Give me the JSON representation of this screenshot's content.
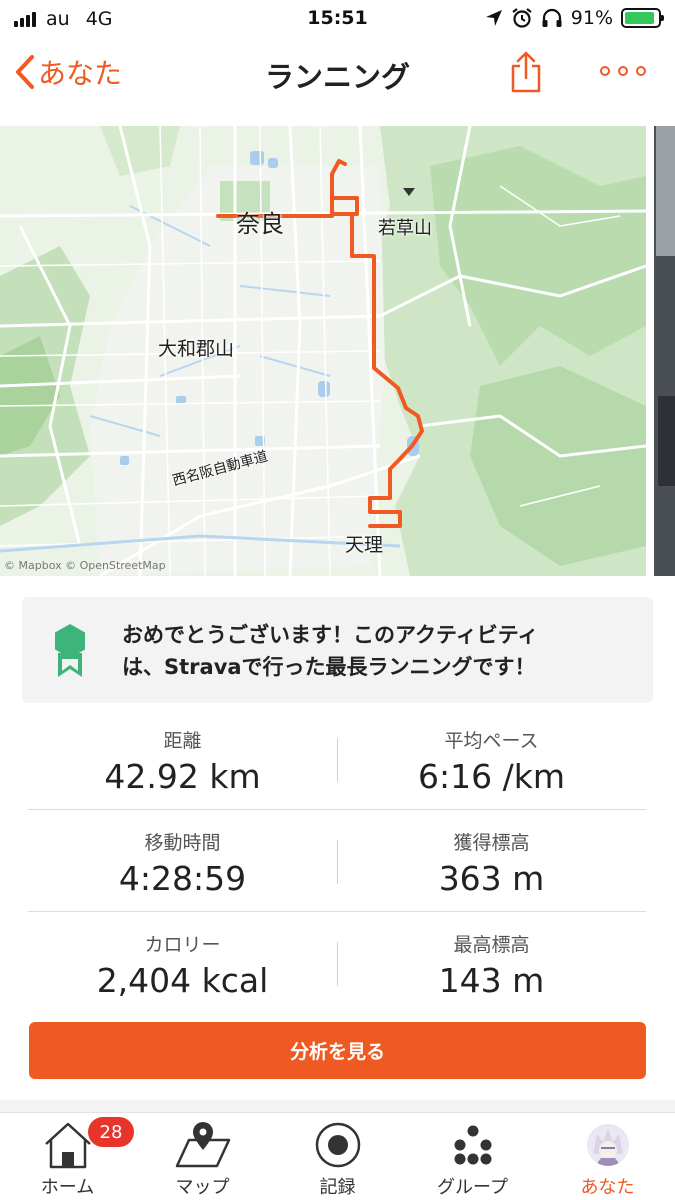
{
  "status_bar": {
    "carrier": "au",
    "network": "4G",
    "time": "15:51",
    "battery": "91%",
    "battery_level": 0.91
  },
  "nav": {
    "back_label": "あなた",
    "title": "ランニング"
  },
  "map": {
    "labels": {
      "nara": "奈良",
      "wakakusayama": "若草山",
      "yamatokoriyama": "大和郡山",
      "expressway": "西名阪自動車道",
      "tenri": "天理"
    },
    "credit": "© Mapbox © OpenStreetMap",
    "route_color": "#f05a22"
  },
  "achievement": {
    "text_line1": "おめでとうございます！このアクティビティ",
    "text_line2": "は、Stravaで行った最長ランニングです！"
  },
  "stats": [
    [
      {
        "label": "距離",
        "value": "42.92 km"
      },
      {
        "label": "平均ペース",
        "value": "6:16 /km"
      }
    ],
    [
      {
        "label": "移動時間",
        "value": "4:28:59"
      },
      {
        "label": "獲得標高",
        "value": "363 m"
      }
    ],
    [
      {
        "label": "カロリー",
        "value": "2,404 kcal"
      },
      {
        "label": "最高標高",
        "value": "143 m"
      }
    ]
  ],
  "cta": {
    "label": "分析を見る"
  },
  "tabs": [
    {
      "label": "ホーム",
      "icon": "home-icon",
      "badge": "28"
    },
    {
      "label": "マップ",
      "icon": "map-icon"
    },
    {
      "label": "記録",
      "icon": "record-icon"
    },
    {
      "label": "グループ",
      "icon": "groups-icon"
    },
    {
      "label": "あなた",
      "icon": "avatar",
      "active": true
    }
  ],
  "colors": {
    "accent": "#f05a22",
    "badge": "#e8352c",
    "achievement_icon": "#3db57a"
  }
}
